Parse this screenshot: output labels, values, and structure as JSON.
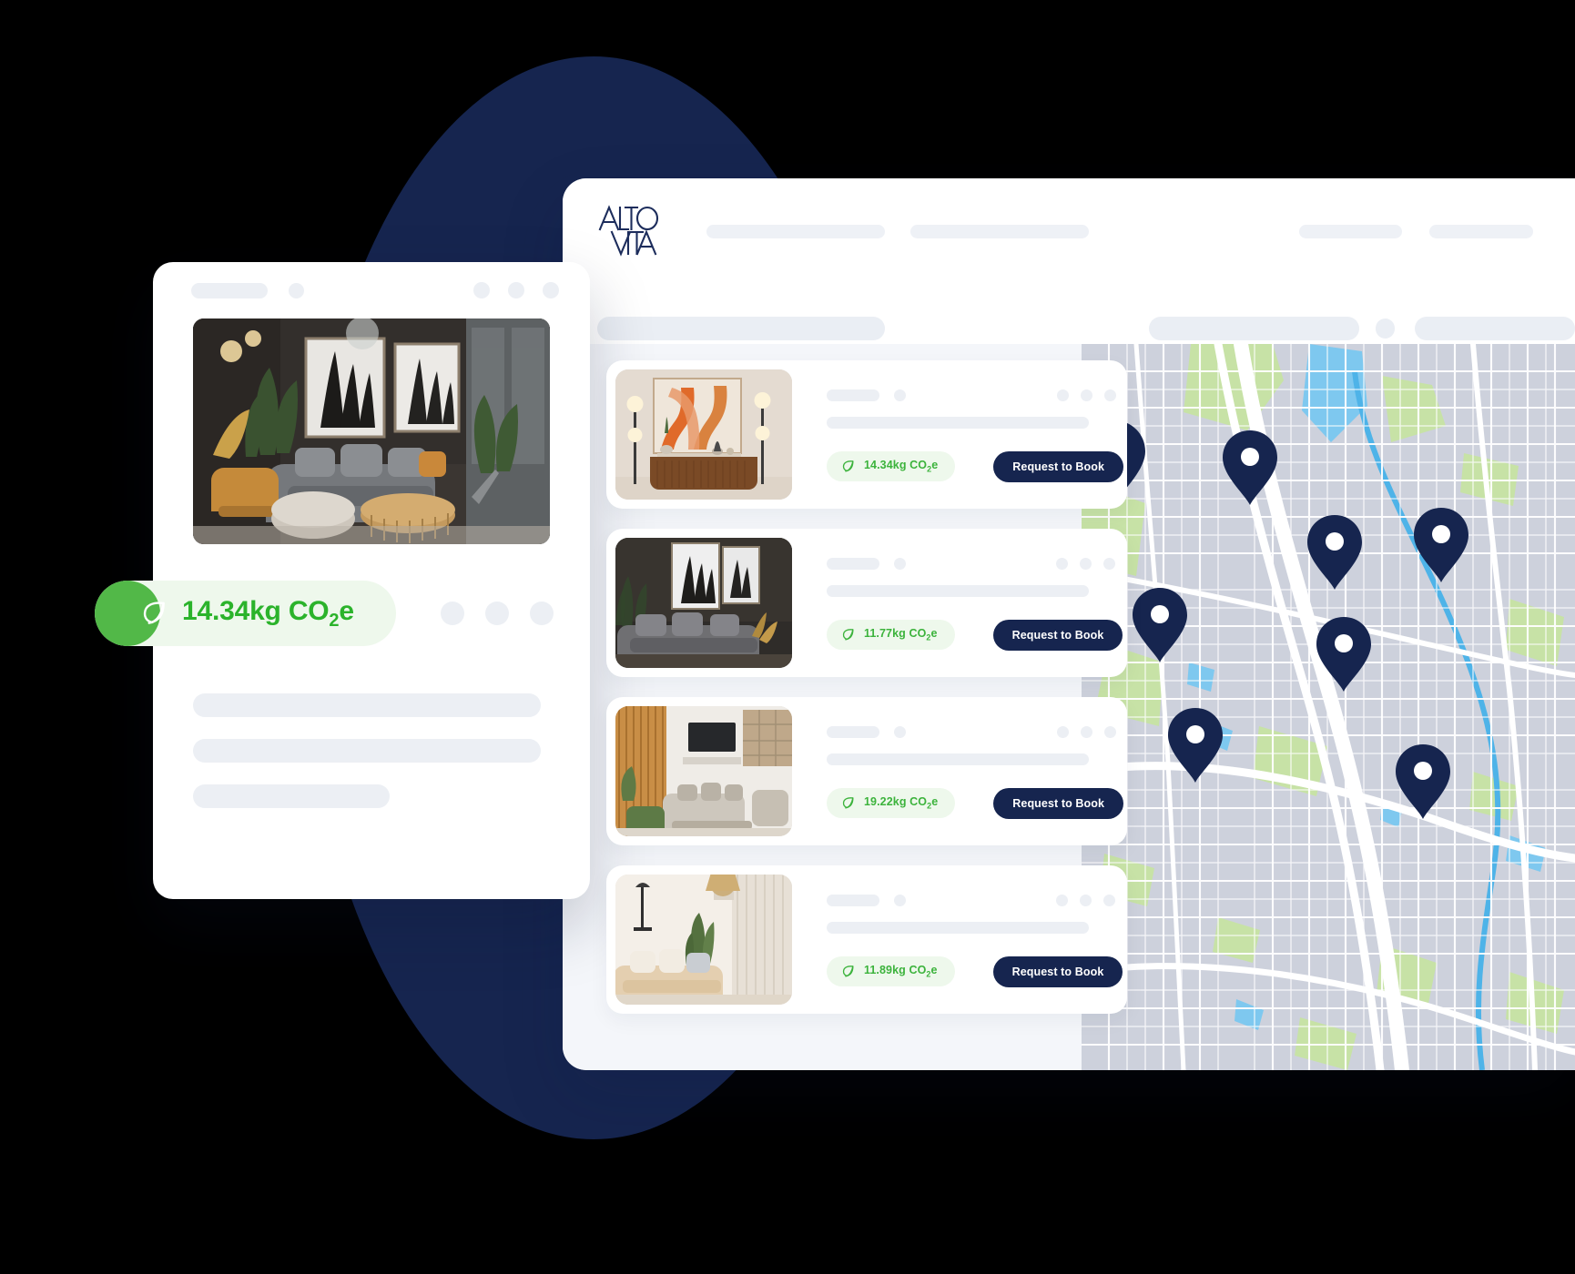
{
  "brand": {
    "name": "ALTO VITA",
    "logo_line1": "ALTO",
    "logo_line2": "VITA",
    "navy": "#16254f",
    "green": "#3cb33c",
    "green_solid": "#52b848",
    "badge_bg": "#eef8ec"
  },
  "front_card": {
    "co2_badge": {
      "icon": "leaf-icon",
      "value": "14.34kg CO",
      "subscript": "2",
      "suffix": "e",
      "full_text": "14.34kg CO2e"
    }
  },
  "listings": [
    {
      "co2_value": "14.34kg CO",
      "co2_sub": "2",
      "co2_suffix": "e",
      "book_label": "Request to Book",
      "image_alt": "orange-abstract-art-console-table"
    },
    {
      "co2_value": "11.77kg CO",
      "co2_sub": "2",
      "co2_suffix": "e",
      "book_label": "Request to Book",
      "image_alt": "dark-living-room-grey-sofa"
    },
    {
      "co2_value": "19.22kg CO",
      "co2_sub": "2",
      "co2_suffix": "e",
      "book_label": "Request to Book",
      "image_alt": "modern-lounge-wood-slats-tv"
    },
    {
      "co2_value": "11.89kg CO",
      "co2_sub": "2",
      "co2_suffix": "e",
      "book_label": "Request to Book",
      "image_alt": "bright-bedroom-beige-sofa"
    }
  ],
  "map": {
    "pin_color": "#16254f",
    "pin_count": 8,
    "base_color": "#cdd1dc",
    "park_color": "#c9e3a8",
    "water_color": "#7ec8ef",
    "road_color": "#ffffff"
  }
}
